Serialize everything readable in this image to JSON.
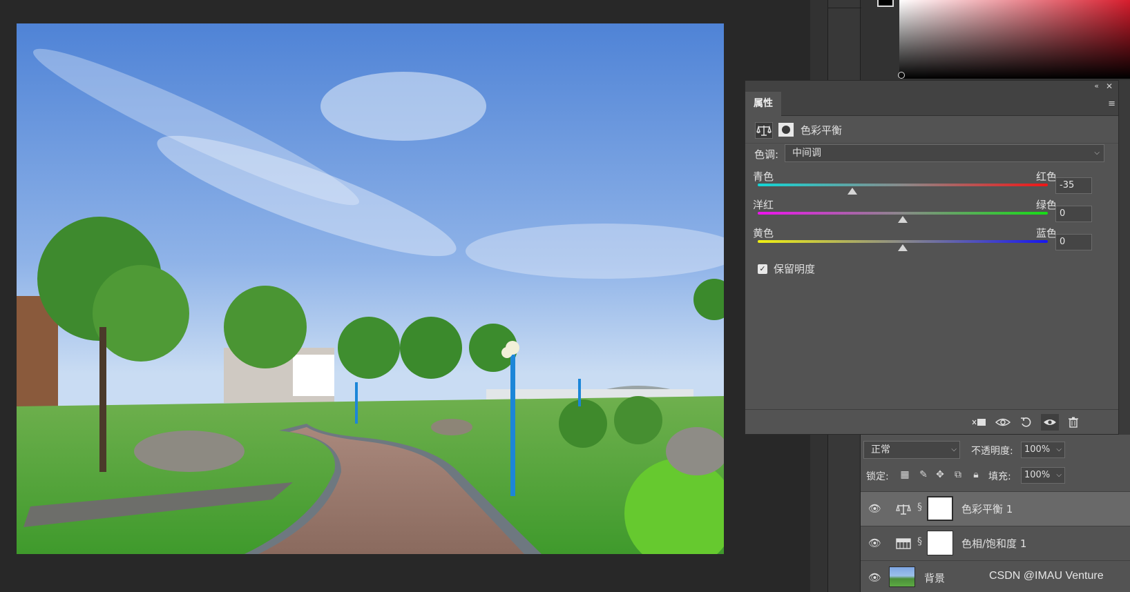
{
  "canvas": {
    "image": "park-photo"
  },
  "properties_panel": {
    "tab_label": "属性",
    "collapse_glyph": "«",
    "close_glyph": "✕",
    "menu_glyph": "≡",
    "adjustment_title": "色彩平衡",
    "tone_label": "色调:",
    "tone_value": "中间调",
    "sliders": [
      {
        "left_label": "青色",
        "right_label": "红色",
        "value": "-35",
        "min": -100,
        "max": 100,
        "colors": [
          "#12d6d6",
          "#f01616"
        ]
      },
      {
        "left_label": "洋红",
        "right_label": "绿色",
        "value": "0",
        "min": -100,
        "max": 100,
        "colors": [
          "#ee12ee",
          "#16dd16"
        ]
      },
      {
        "left_label": "黄色",
        "right_label": "蓝色",
        "value": "0",
        "min": -100,
        "max": 100,
        "colors": [
          "#f0f012",
          "#1616f0"
        ]
      }
    ],
    "preserve_luminosity_label": "保留明度",
    "preserve_luminosity_checked": true
  },
  "layers_panel": {
    "blend_mode": "正常",
    "opacity_label": "不透明度:",
    "opacity_value": "100%",
    "lock_label": "锁定:",
    "fill_label": "填充:",
    "fill_value": "100%",
    "layers": [
      {
        "name": "色彩平衡 1",
        "type": "color-balance",
        "selected": true,
        "visible": true
      },
      {
        "name": "色相/饱和度 1",
        "type": "hue-saturation",
        "selected": false,
        "visible": true
      },
      {
        "name": "背景",
        "type": "background",
        "selected": false,
        "visible": true
      }
    ]
  },
  "watermark": "CSDN @IMAU Venture"
}
